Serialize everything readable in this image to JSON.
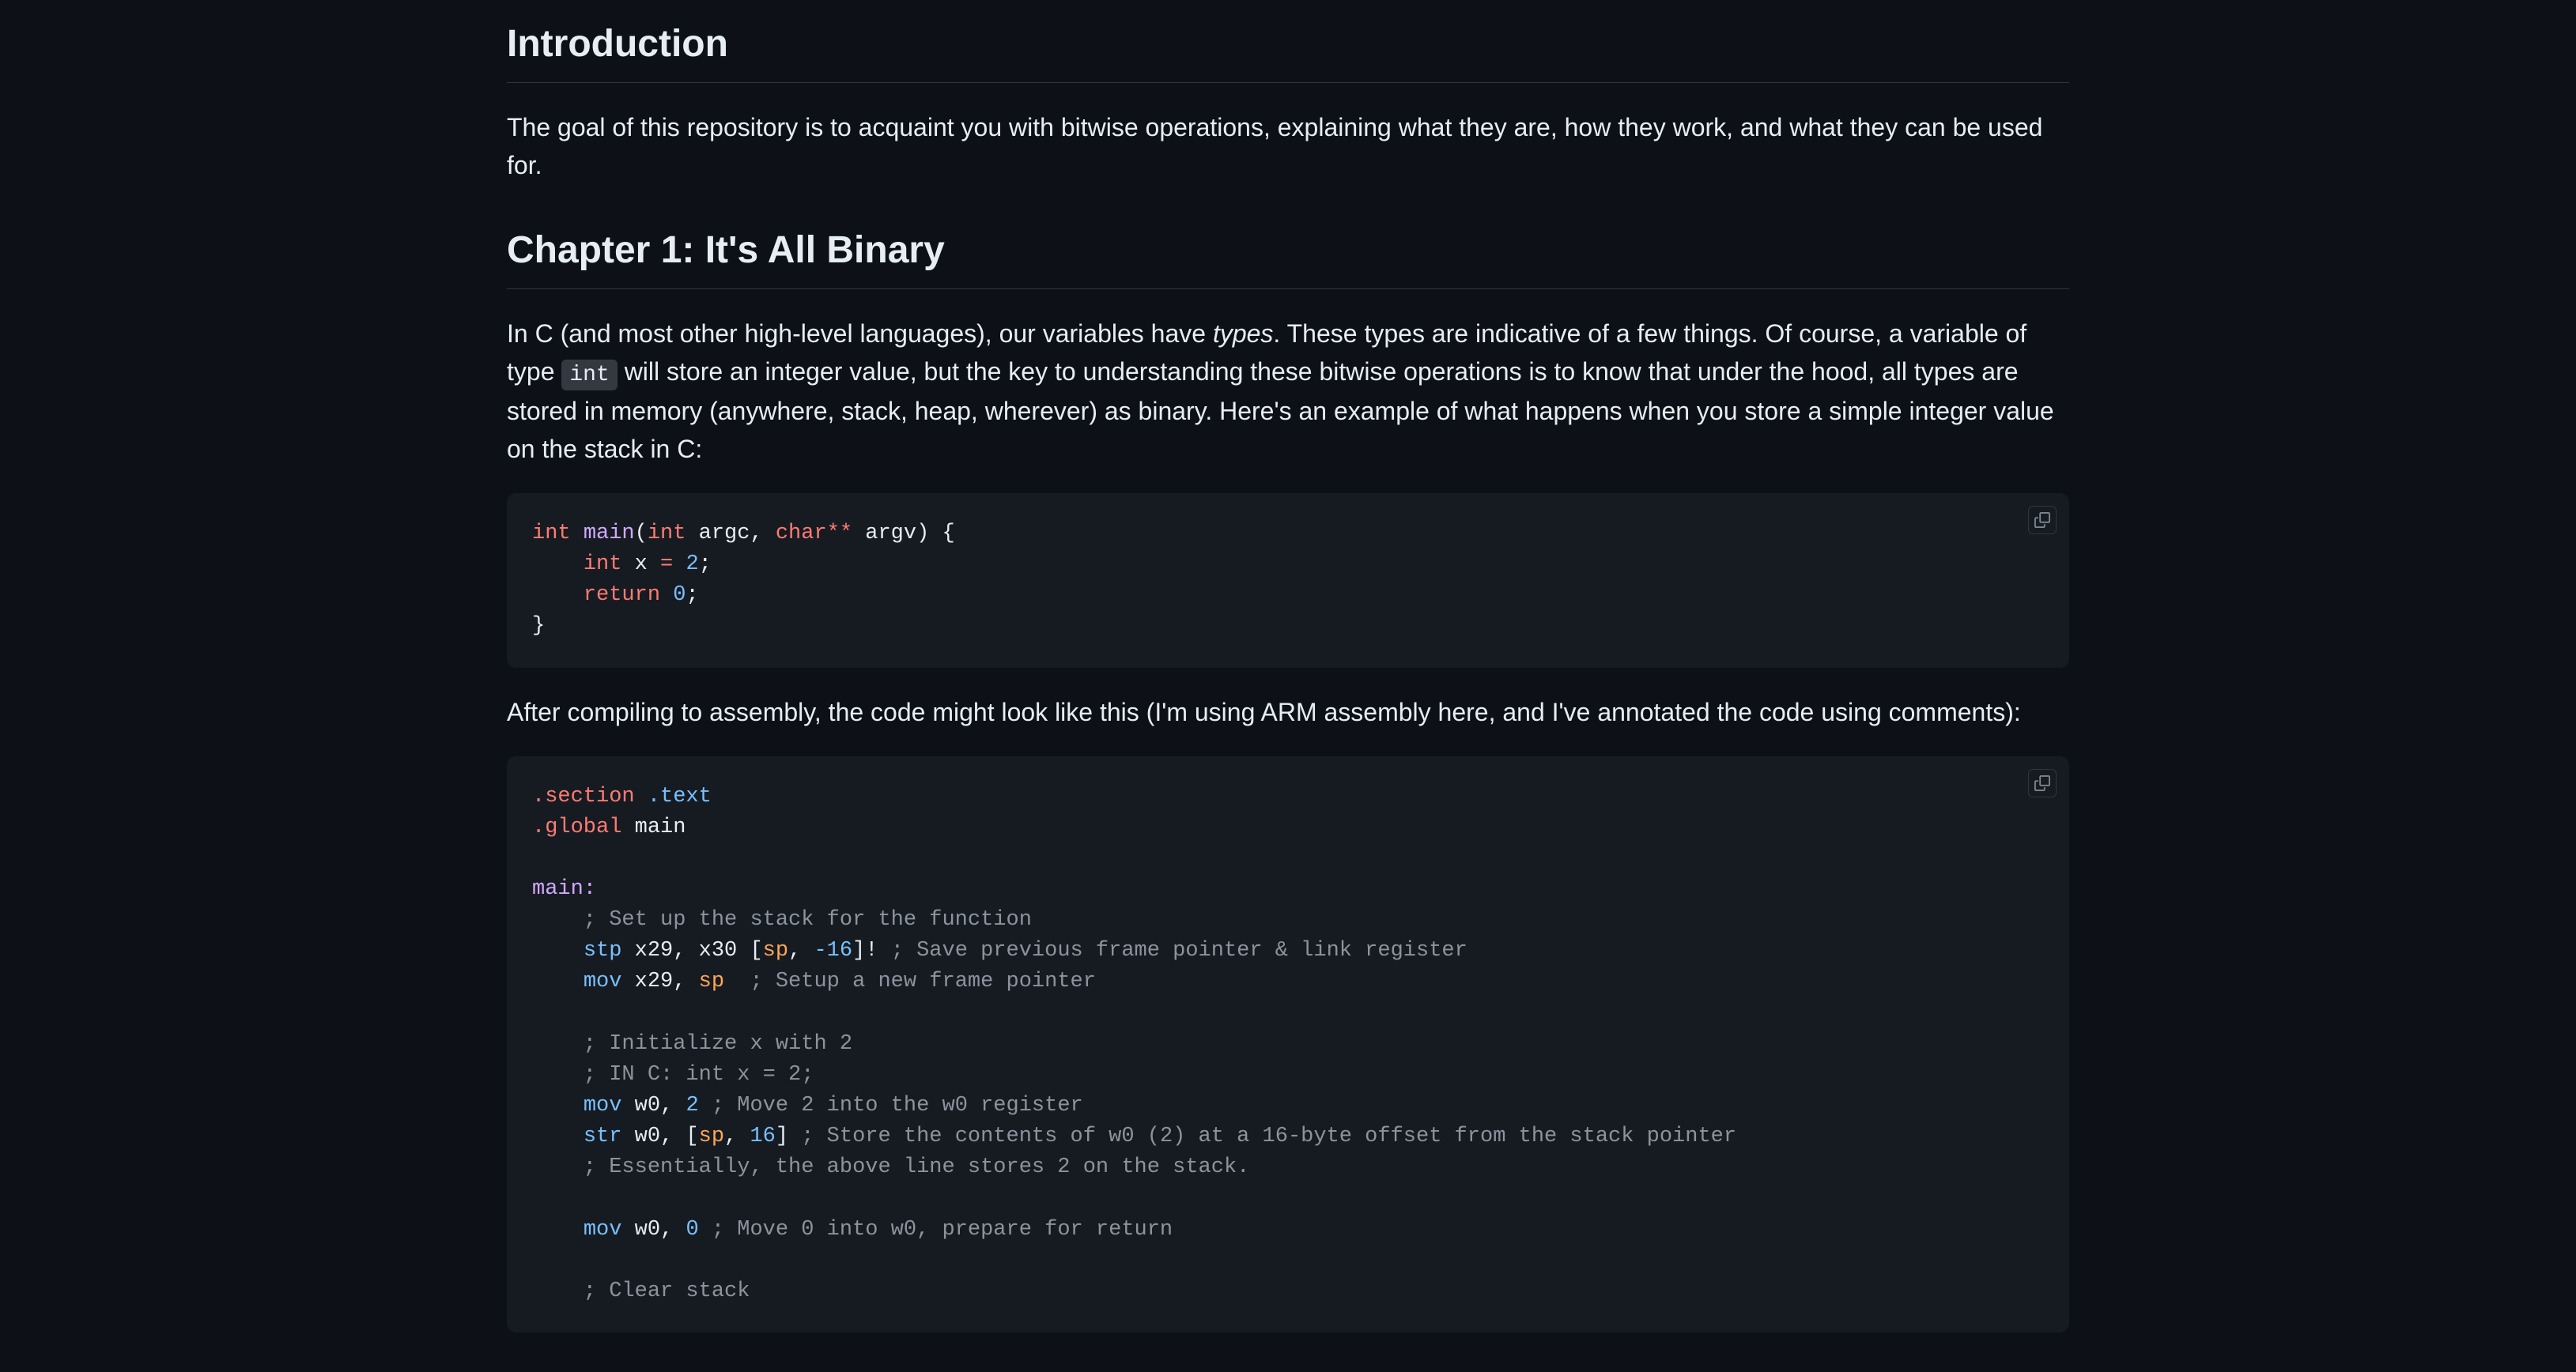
{
  "headings": {
    "intro": "Introduction",
    "chapter1": "Chapter 1: It's All Binary"
  },
  "paragraphs": {
    "intro_body": "The goal of this repository is to acquaint you with bitwise operations, explaining what they are, how they work, and what they can be used for.",
    "ch1_p1_a": "In C (and most other high-level languages), our variables have ",
    "ch1_p1_types": "types",
    "ch1_p1_b": ". These types are indicative of a few things. Of course, a variable of type ",
    "ch1_p1_int": "int",
    "ch1_p1_c": " will store an integer value, but the key to understanding these bitwise operations is to know that under the hood, all types are stored in memory (anywhere, stack, heap, wherever) as binary. Here's an example of what happens when you store a simple integer value on the stack in C:",
    "ch1_p2": "After compiling to assembly, the code might look like this (I'm using ARM assembly here, and I've annotated the code using comments):"
  },
  "code_c": {
    "int1": "int",
    "main": "main",
    "lparen": "(",
    "int2": "int",
    "argc": " argc, ",
    "char": "char",
    "stars": "**",
    "argv": " argv) {",
    "line2_indent": "    ",
    "int3": "int",
    "xeq": " x ",
    "eq": "=",
    "sp": " ",
    "two": "2",
    "semi1": ";",
    "line3_indent": "    ",
    "return": "return",
    "sp2": " ",
    "zero": "0",
    "semi2": ";",
    "rbrace": "}"
  },
  "code_asm": {
    "l1a": ".section",
    "l1b": " .text",
    "l2a": ".global",
    "l2b": " main",
    "l4": "main:",
    "l5": "    ; Set up the stack for the function",
    "l6_stp": "stp",
    "l6_a": " x29, x30 [",
    "l6_sp": "sp",
    "l6_b": ", ",
    "l6_n16": "-16",
    "l6_c": "]! ",
    "l6_cm": "; Save previous frame pointer & link register",
    "l7_mov": "mov",
    "l7_a": " x29, ",
    "l7_sp": "sp",
    "l7_b": "  ",
    "l7_cm": "; Setup a new frame pointer",
    "l9": "    ; Initialize x with 2",
    "l10": "    ; IN C: int x = 2;",
    "l11_mov": "mov",
    "l11_a": " w0, ",
    "l11_2": "2",
    "l11_b": " ",
    "l11_cm": "; Move 2 into the w0 register",
    "l12_str": "str",
    "l12_a": " w0, [",
    "l12_sp": "sp",
    "l12_b": ", ",
    "l12_16": "16",
    "l12_c": "] ",
    "l12_cm": "; Store the contents of w0 (2) at a 16-byte offset from the stack pointer",
    "l13": "    ; Essentially, the above line stores 2 on the stack.",
    "l15_mov": "mov",
    "l15_a": " w0, ",
    "l15_0": "0",
    "l15_b": " ",
    "l15_cm": "; Move 0 into w0, prepare for return",
    "l17": "    ; Clear stack"
  },
  "icons": {
    "copy": "copy-icon"
  }
}
